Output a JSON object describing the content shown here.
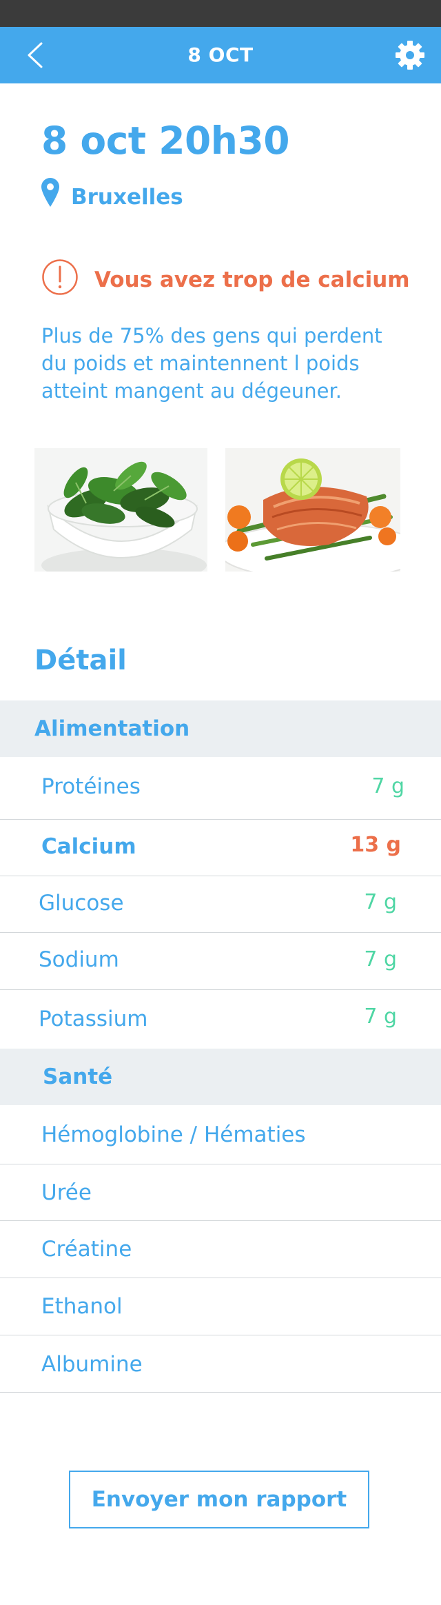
{
  "navbar": {
    "title": "8 OCT",
    "back_icon": "chevron-left-icon",
    "settings_icon": "gear-icon"
  },
  "header": {
    "datetime": "8 oct 20h30",
    "location": "Bruxelles",
    "location_icon": "map-pin-icon"
  },
  "alert": {
    "icon": "alert-circle-icon",
    "text": "Vous avez trop de calcium",
    "description": "Plus de 75% des gens qui perdent du poids et maintennent l poids atteint mangent au dégeuner."
  },
  "photos": [
    {
      "name": "spinach-photo"
    },
    {
      "name": "salmon-photo"
    }
  ],
  "detail": {
    "title": "Détail",
    "alimentation": {
      "label": "Alimentation",
      "items": [
        {
          "label": "Protéines",
          "value": "7 g",
          "status": "normal"
        },
        {
          "label": "Calcium",
          "value": "13 g",
          "status": "alert"
        },
        {
          "label": "Glucose",
          "value": "7 g",
          "status": "normal"
        },
        {
          "label": "Sodium",
          "value": "7 g",
          "status": "normal"
        },
        {
          "label": "Potassium",
          "value": "7 g",
          "status": "normal"
        }
      ]
    },
    "sante": {
      "label": "Santé",
      "items": [
        {
          "label": "Hémoglobine / Hématies"
        },
        {
          "label": "Urée"
        },
        {
          "label": "Créatine"
        },
        {
          "label": "Ethanol"
        },
        {
          "label": "Albumine"
        }
      ]
    }
  },
  "footer": {
    "send_label": "Envoyer mon rapport"
  },
  "colors": {
    "accent": "#44a8ec",
    "alert": "#ec6f4a",
    "normal_value": "#4fd6a4",
    "group_bg": "#ebeff2"
  }
}
